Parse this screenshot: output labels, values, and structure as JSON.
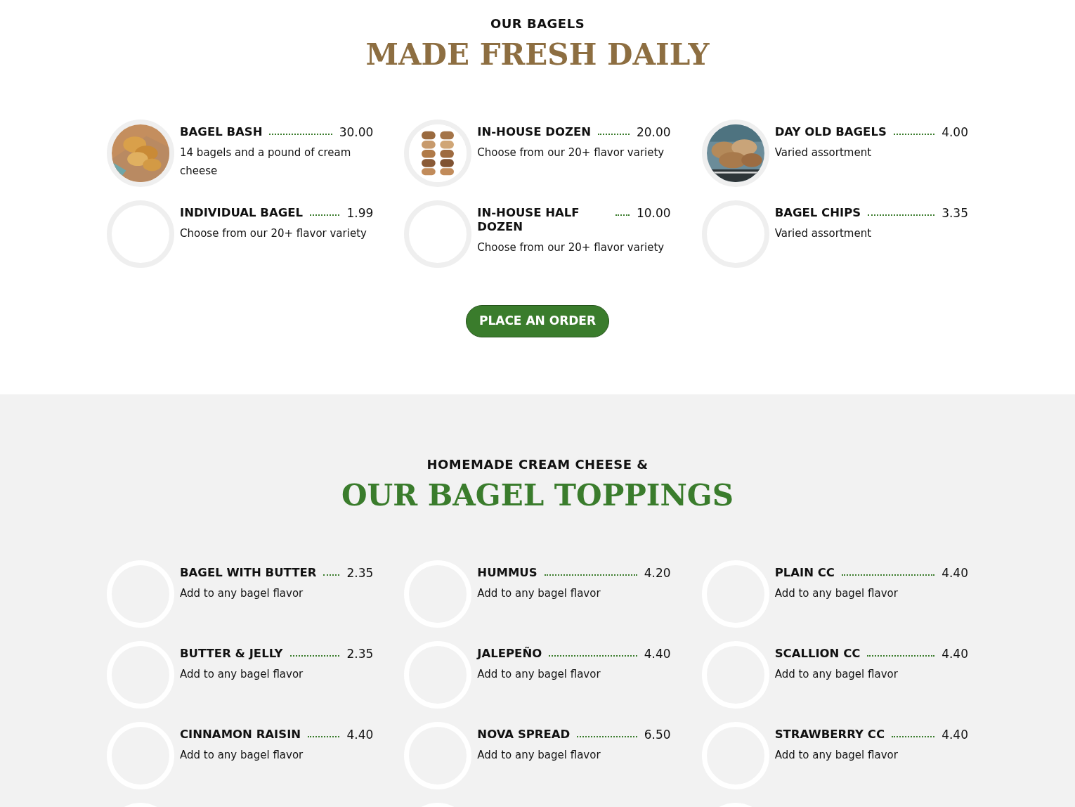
{
  "sections": [
    {
      "kicker": "OUR BAGELS",
      "title": "MADE FRESH DAILY",
      "items": [
        {
          "kind": "picture",
          "name": "BAGEL BASH",
          "price": "30.00",
          "description": "14 bagels and a pound of cream cheese"
        },
        {
          "kind": "picture",
          "name": "IN-HOUSE DOZEN",
          "price": "20.00",
          "description": "Choose from our 20+ flavor variety"
        },
        {
          "kind": "picture",
          "name": "DAY OLD BAGELS",
          "price": "4.00",
          "description": "Varied assortment"
        },
        {
          "kind": "empty",
          "name": "INDIVIDUAL BAGEL",
          "price": "1.99",
          "description": "Choose from our 20+ flavor variety"
        },
        {
          "kind": "empty",
          "name": "IN-HOUSE HALF DOZEN",
          "price": "10.00",
          "description": "Choose from our 20+ flavor variety"
        },
        {
          "kind": "empty",
          "name": "BAGEL CHIPS",
          "price": "3.35",
          "description": "Varied assortment"
        }
      ],
      "button": "PLACE AN ORDER"
    },
    {
      "kicker": "HOMEMADE CREAM CHEESE &",
      "title": "OUR BAGEL TOPPINGS",
      "items": [
        {
          "kind": "empty",
          "name": "BAGEL WITH BUTTER",
          "price": "2.35",
          "description": "Add to any bagel flavor"
        },
        {
          "kind": "empty",
          "name": "HUMMUS",
          "price": "4.20",
          "description": "Add to any bagel flavor"
        },
        {
          "kind": "empty",
          "name": "PLAIN CC",
          "price": "4.40",
          "description": "Add to any bagel flavor"
        },
        {
          "kind": "empty",
          "name": "BUTTER & JELLY",
          "price": "2.35",
          "description": "Add to any bagel flavor"
        },
        {
          "kind": "empty",
          "name": "JALEPEÑO",
          "price": "4.40",
          "description": "Add to any bagel flavor"
        },
        {
          "kind": "empty",
          "name": "SCALLION CC",
          "price": "4.40",
          "description": "Add to any bagel flavor"
        },
        {
          "kind": "empty",
          "name": "CINNAMON RAISIN",
          "price": "4.40",
          "description": "Add to any bagel flavor"
        },
        {
          "kind": "empty",
          "name": "NOVA SPREAD",
          "price": "6.50",
          "description": "Add to any bagel flavor"
        },
        {
          "kind": "empty",
          "name": "STRAWBERRY CC",
          "price": "4.40",
          "description": "Add to any bagel flavor"
        },
        {
          "kind": "ring"
        },
        {
          "kind": "ring"
        },
        {
          "kind": "ring"
        }
      ]
    }
  ]
}
